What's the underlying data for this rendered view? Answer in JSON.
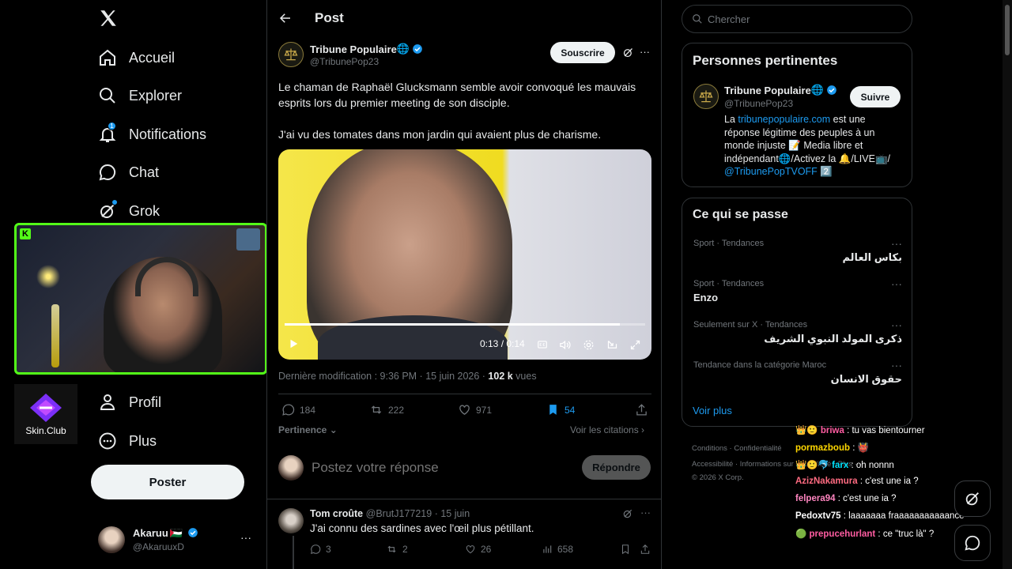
{
  "sidebar": {
    "logo": "X",
    "items": [
      {
        "label": "Accueil",
        "icon": "home-icon"
      },
      {
        "label": "Explorer",
        "icon": "search-icon"
      },
      {
        "label": "Notifications",
        "icon": "bell-icon",
        "badge": "1"
      },
      {
        "label": "Chat",
        "icon": "chat-icon"
      },
      {
        "label": "Grok",
        "icon": "grok-icon"
      },
      {
        "label": "Profil",
        "icon": "person-icon"
      },
      {
        "label": "Plus",
        "icon": "more-circle-icon"
      }
    ],
    "post_button": "Poster",
    "account": {
      "name": "Akaruu",
      "flag": "🇵🇸",
      "handle": "@AkaruuxD"
    }
  },
  "sponsor": {
    "label": "Skin.Club"
  },
  "post": {
    "header_title": "Post",
    "author": {
      "name": "Tribune Populaire",
      "handle": "@TribunePop23",
      "globe": "🌐"
    },
    "subscribe_label": "Souscrire",
    "text_line1": "Le chaman de Raphaël Glucksmann semble avoir convoqué les mauvais",
    "text_line2": "esprits lors du premier meeting de son disciple.",
    "text_line3": "J'ai vu des tomates dans mon jardin qui avaient plus de charisme.",
    "video": {
      "time": "0:13 / 0:14",
      "progress": 0.93
    },
    "meta_prefix": "Dernière modification : 9:36 PM · 15 juin 2026 · ",
    "views_count": "102 k",
    "views_label": " vues",
    "stats": {
      "replies": "184",
      "reposts": "222",
      "likes": "971",
      "bookmarks": "54"
    },
    "sort_label": "Pertinence",
    "quotes_label": "Voir les citations",
    "reply_placeholder": "Postez votre réponse",
    "reply_button": "Répondre"
  },
  "reply": {
    "name": "Tom croûte",
    "handle": "@BrutJ177219",
    "date": "· 15 juin",
    "text": "J'ai connu des sardines avec l'œil plus pétillant.",
    "stats": {
      "replies": "3",
      "reposts": "2",
      "likes": "26",
      "views": "658"
    }
  },
  "right": {
    "search_placeholder": "Chercher",
    "relevant": {
      "title": "Personnes pertinentes",
      "name": "Tribune Populaire",
      "handle": "@TribunePop23",
      "follow": "Suivre",
      "bio_pre": "La ",
      "bio_link": "tribunepopulaire.com",
      "bio_line1": " est une",
      "bio_line2": "réponse légitime des peuples à un",
      "bio_line3": "monde injuste 📝 Media libre et",
      "bio_line4": "indépendant🌐/Activez la 🔔/LIVE📺/",
      "bio_link2": "@TribunePopTVOFF",
      "bio_end": " 2️⃣"
    },
    "trends": {
      "title": "Ce qui se passe",
      "items": [
        {
          "meta": "Sport · Tendances",
          "name": "بكاس العالم"
        },
        {
          "meta": "Sport · Tendances",
          "name": "Enzo"
        },
        {
          "meta": "Seulement sur X · Tendances",
          "name": "ذكرى المولد النبوي الشريف"
        },
        {
          "meta": "Tendance dans la catégorie Maroc",
          "name": "حقوق الانسان"
        }
      ],
      "more": "Voir plus"
    },
    "footer": {
      "line1": "Conditions  ·  Confidentialité",
      "line2": "Accessibilité  ·  Informations sur la publicité  ·  Plus ···",
      "line3": "© 2026 X Corp."
    }
  },
  "chat": [
    {
      "user": "briwa",
      "color": "#ff5da2",
      "msg": ": tu vas bientourner",
      "icons": "👑🙂"
    },
    {
      "user": "pormazboub",
      "color": "#ffd700",
      "msg": ": 👹",
      "icons": ""
    },
    {
      "user": "farx",
      "color": "#00e5ff",
      "msg": ": oh nonnn",
      "icons": "👑🙂🐬"
    },
    {
      "user": "AzizNakamura",
      "color": "#ff6b81",
      "msg": ": c'est une ia ?",
      "icons": ""
    },
    {
      "user": "felpera94",
      "color": "#ff85c0",
      "msg": ": c'est une ia ?",
      "icons": ""
    },
    {
      "user": "Pedoxtv75",
      "color": "#ffffff",
      "msg": ": laaaaaaa fraaaaaaaaaaance",
      "icons": ""
    },
    {
      "user": "prepucehurlant",
      "color": "#ff5da2",
      "msg": ": ce \"truc là\" ?",
      "icons": "🟢"
    }
  ],
  "colors": {
    "accent": "#1d9bf0",
    "stream_border": "#53fc18",
    "background": "#000000",
    "border": "#2f3336"
  }
}
